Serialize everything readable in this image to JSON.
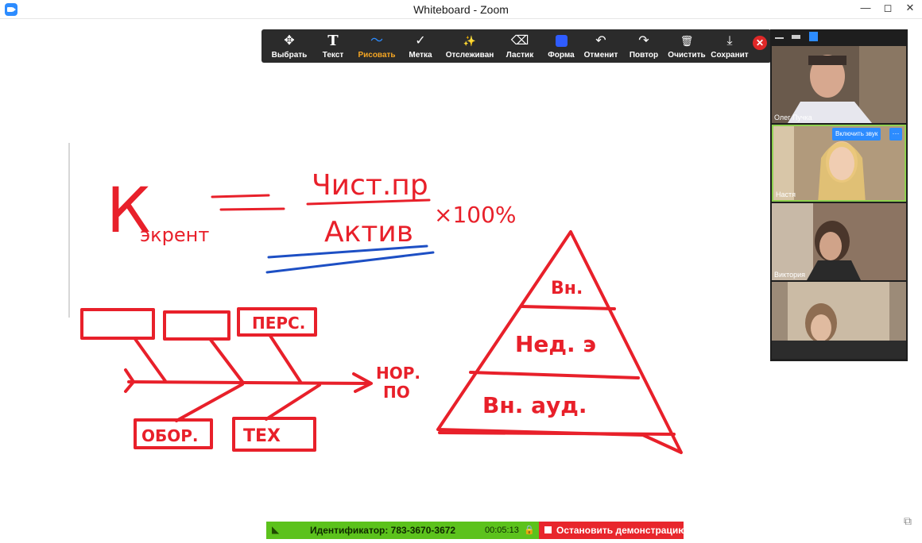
{
  "window": {
    "title": "Whiteboard - Zoom",
    "app_icon": "zoom-icon",
    "controls": [
      "—",
      "◻",
      "✕"
    ]
  },
  "toolbar": {
    "tools": [
      {
        "label": "Выбрать",
        "icon": "move-arrows-icon",
        "glyph": "✥"
      },
      {
        "label": "Текст",
        "icon": "text-icon",
        "glyph": "T"
      },
      {
        "label": "Рисовать",
        "icon": "draw-squiggle-icon",
        "glyph": "〜"
      },
      {
        "label": "Метка",
        "icon": "checkmark-icon",
        "glyph": "✓"
      },
      {
        "label": "Отслеживан",
        "icon": "spotlight-wand-icon",
        "glyph": "✨"
      },
      {
        "label": "Ластик",
        "icon": "eraser-icon",
        "glyph": "⌫"
      },
      {
        "label": "Форма",
        "icon": "shape-square-icon",
        "glyph": ""
      },
      {
        "label": "Отменит",
        "icon": "undo-icon",
        "glyph": "↶"
      },
      {
        "label": "Повтор",
        "icon": "redo-icon",
        "glyph": "↷"
      },
      {
        "label": "Очистить",
        "icon": "trash-icon",
        "glyph": "🗑"
      },
      {
        "label": "Сохранит",
        "icon": "save-download-icon",
        "glyph": "⤓"
      }
    ],
    "active_tool": "Рисовать",
    "close_glyph": "✕",
    "active_color": "#f5a623",
    "pen_color": "#e8202a"
  },
  "whiteboard": {
    "formula": {
      "lhs": "К",
      "lhs_sub": "экрент",
      "numerator": "Чист.пр",
      "denominator": "Актив",
      "multiplier": "×100%"
    },
    "fishbone": {
      "top_boxes": [
        "",
        "",
        "ПЕРС."
      ],
      "bottom_boxes": [
        "ОБОР.",
        "ТЕХ"
      ],
      "head_label_1": "НОР.",
      "head_label_2": "ПО"
    },
    "pyramid": {
      "levels": [
        "Вн.",
        "Нед. э",
        "Вн. ауд."
      ]
    }
  },
  "video_panel": {
    "participants": [
      {
        "name": "Олег Пучка"
      },
      {
        "name": "Настя",
        "unmute_label": "Включить звук",
        "more_label": "···"
      },
      {
        "name": "Виктория"
      },
      {
        "name": ""
      }
    ]
  },
  "meeting_bar": {
    "id_text": "Идентификатор: 783-3670-3672",
    "time": "00:05:13",
    "stop_label": "Остановить демонстрацию",
    "signal_icon": "signal-icon",
    "lock_icon": "lock-icon"
  }
}
